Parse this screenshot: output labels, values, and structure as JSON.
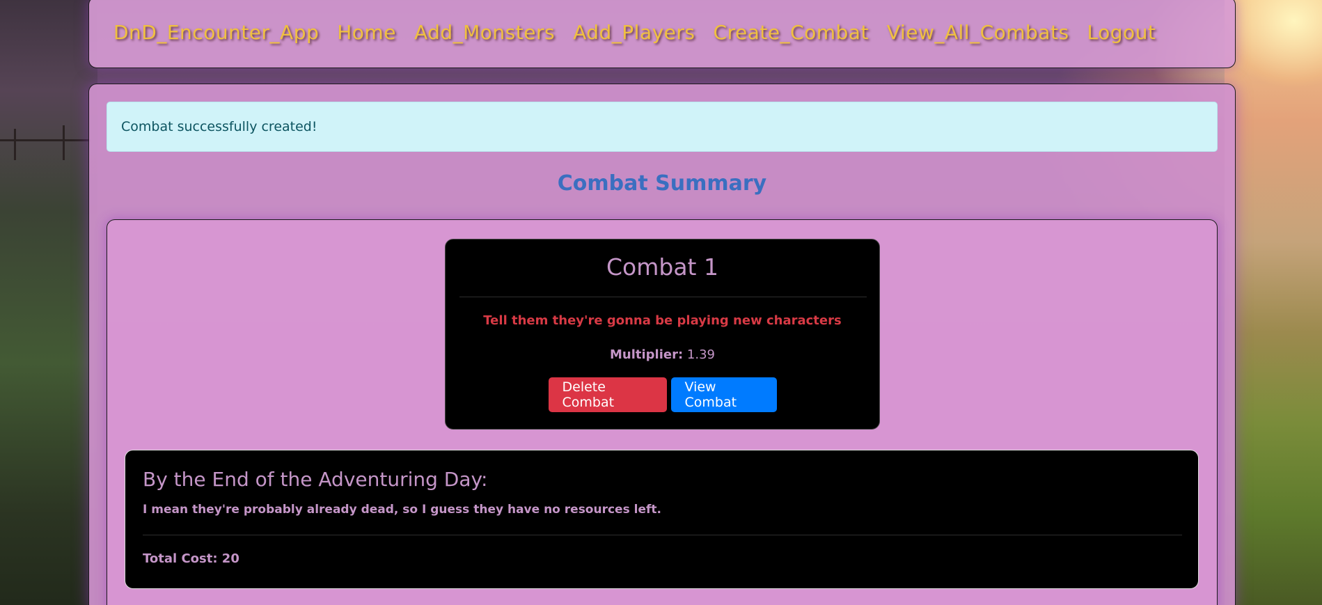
{
  "navbar": {
    "brand": "DnD_Encounter_App",
    "items": [
      {
        "label": "Home"
      },
      {
        "label": "Add_Monsters"
      },
      {
        "label": "Add_Players"
      },
      {
        "label": "Create_Combat"
      },
      {
        "label": "View_All_Combats"
      },
      {
        "label": "Logout"
      }
    ]
  },
  "alert": {
    "message": "Combat successfully created!"
  },
  "summary": {
    "title": "Combat Summary"
  },
  "combat": {
    "name": "Combat 1",
    "note": "Tell them they're gonna be playing new characters",
    "multiplier_label": "Multiplier:",
    "multiplier_value": "1.39",
    "delete_label": "Delete Combat",
    "view_label": "View Combat"
  },
  "day": {
    "title": "By the End of the Adventuring Day:",
    "text": "I mean they're probably already dead, so I guess they have no resources left.",
    "total_cost": "Total Cost: 20"
  },
  "colors": {
    "nav_text": "#f0c040",
    "panel_bg": "#d091cd",
    "alert_bg": "#d0f3f9",
    "title_blue": "#3a6fc0",
    "danger": "#dc3545",
    "primary": "#007bff",
    "note_red": "#d83a45"
  }
}
